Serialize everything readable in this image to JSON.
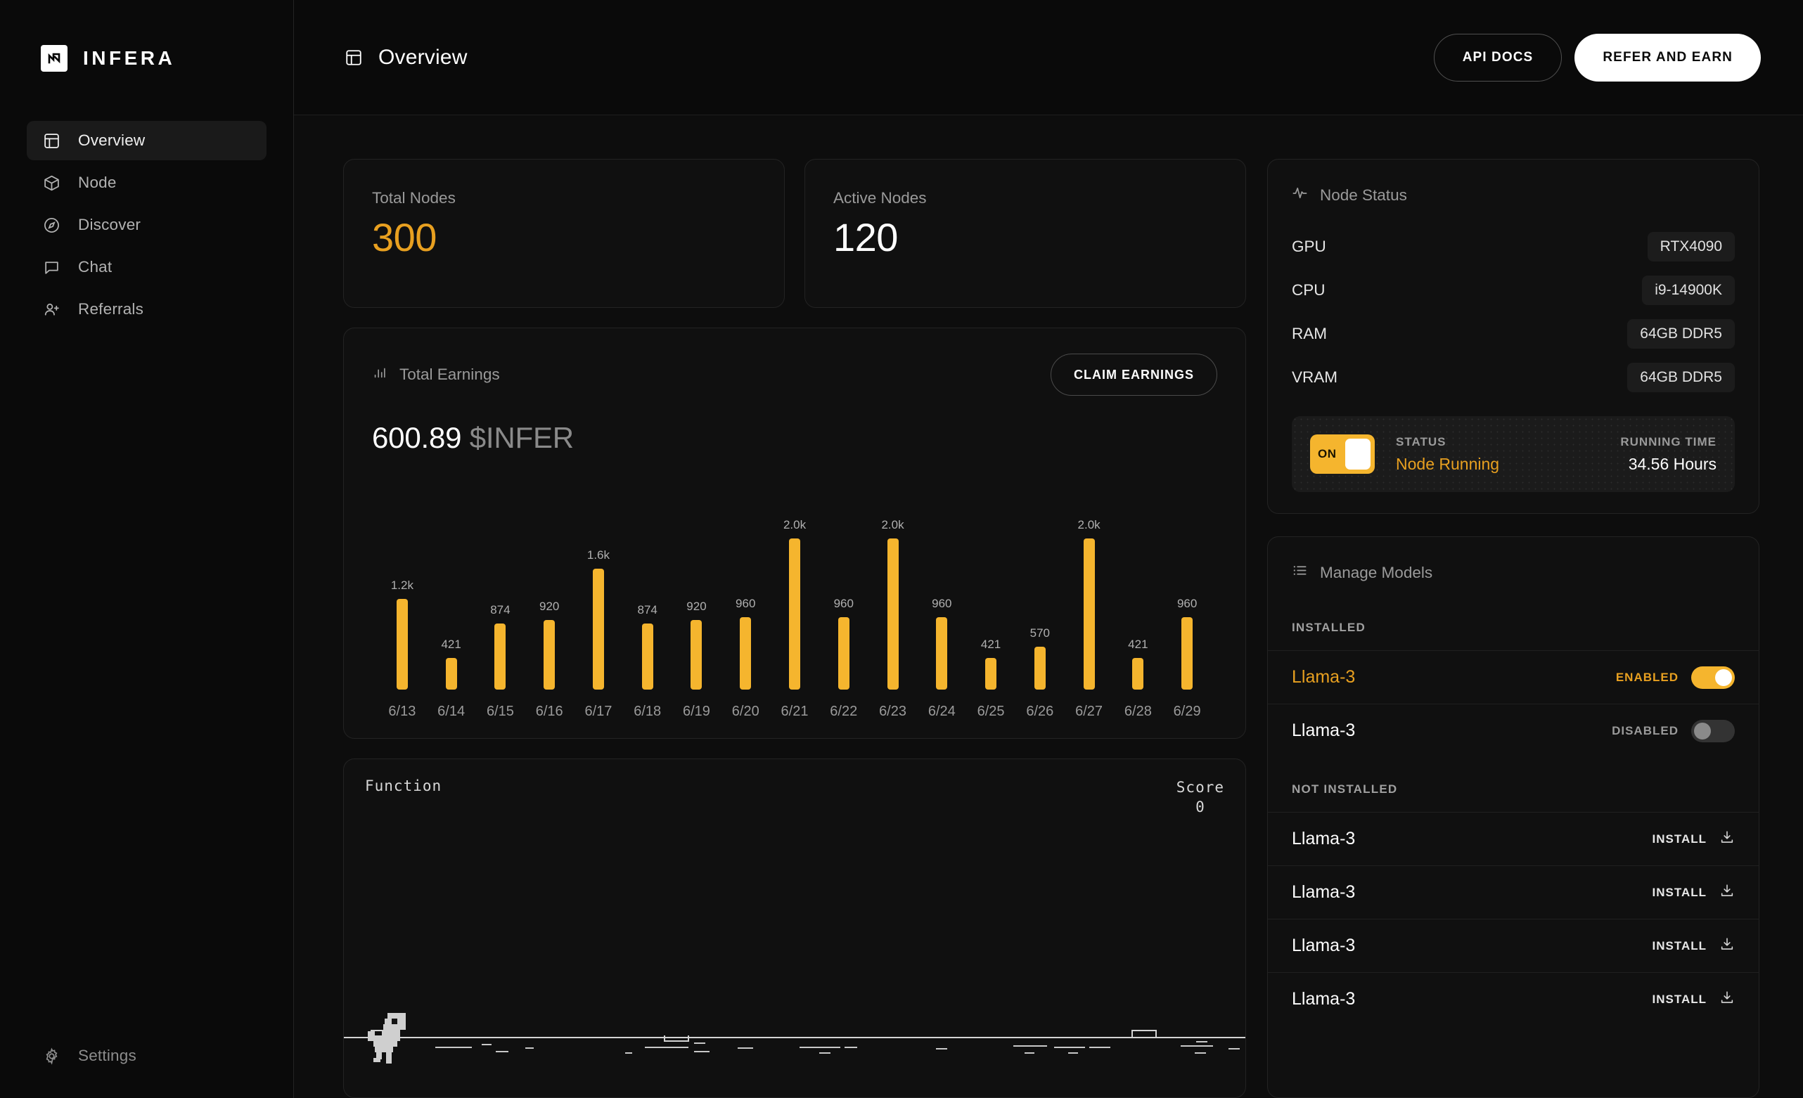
{
  "brand": {
    "name": "INFERA",
    "logo_icon": "infera-logo-icon"
  },
  "sidebar": {
    "items": [
      {
        "label": "Overview",
        "icon": "layout-dashboard-icon",
        "active": true
      },
      {
        "label": "Node",
        "icon": "cube-icon",
        "active": false
      },
      {
        "label": "Discover",
        "icon": "compass-icon",
        "active": false
      },
      {
        "label": "Chat",
        "icon": "chat-bubble-icon",
        "active": false
      },
      {
        "label": "Referrals",
        "icon": "user-plus-icon",
        "active": false
      }
    ],
    "settings": {
      "label": "Settings",
      "icon": "gear-icon"
    }
  },
  "topbar": {
    "title": "Overview",
    "title_icon": "layout-dashboard-icon",
    "api_docs_label": "API DOCS",
    "refer_label": "REFER AND EARN"
  },
  "stats": [
    {
      "label": "Total Nodes",
      "value": "300",
      "color": "#e8a020"
    },
    {
      "label": "Active Nodes",
      "value": "120",
      "color": "#ffffff"
    }
  ],
  "earnings": {
    "title": "Total Earnings",
    "title_icon": "bar-chart-icon",
    "claim_label": "CLAIM EARNINGS",
    "amount": "600.89",
    "ticker": "$INFER"
  },
  "chart_data": {
    "type": "bar",
    "title": "Total Earnings",
    "xlabel": "",
    "ylabel": "",
    "grid": false,
    "legend": "none",
    "bar_color": "#f5b52e",
    "categories": [
      "6/13",
      "6/14",
      "6/15",
      "6/16",
      "6/17",
      "6/18",
      "6/19",
      "6/20",
      "6/21",
      "6/22",
      "6/23",
      "6/24",
      "6/25",
      "6/26",
      "6/27",
      "6/28",
      "6/29"
    ],
    "values": [
      1200,
      421,
      874,
      920,
      1600,
      874,
      920,
      960,
      2000,
      960,
      2000,
      960,
      421,
      570,
      2000,
      421,
      960
    ],
    "value_labels": [
      "1.2k",
      "421",
      "874",
      "920",
      "1.6k",
      "874",
      "920",
      "960",
      "2.0k",
      "960",
      "2.0k",
      "960",
      "421",
      "570",
      "2.0k",
      "421",
      "960"
    ],
    "ylim": [
      0,
      2000
    ]
  },
  "game": {
    "function_label": "Function",
    "score_label": "Score",
    "score_value": "0",
    "dino_icon": "dino-runner-icon"
  },
  "node_status": {
    "title": "Node Status",
    "title_icon": "activity-pulse-icon",
    "specs": [
      {
        "key": "GPU",
        "value": "RTX4090"
      },
      {
        "key": "CPU",
        "value": "i9-14900K"
      },
      {
        "key": "RAM",
        "value": "64GB DDR5"
      },
      {
        "key": "VRAM",
        "value": "64GB DDR5"
      }
    ],
    "toggle_label": "ON",
    "status_caption": "STATUS",
    "status_value": "Node Running",
    "runtime_caption": "RUNNING TIME",
    "runtime_value": "34.56 Hours"
  },
  "manage_models": {
    "title": "Manage Models",
    "title_icon": "list-icon",
    "installed_label": "INSTALLED",
    "not_installed_label": "NOT INSTALLED",
    "installed": [
      {
        "name": "Llama-3",
        "state": "ENABLED",
        "enabled": true
      },
      {
        "name": "Llama-3",
        "state": "DISABLED",
        "enabled": false
      }
    ],
    "not_installed": [
      {
        "name": "Llama-3",
        "action": "INSTALL"
      },
      {
        "name": "Llama-3",
        "action": "INSTALL"
      },
      {
        "name": "Llama-3",
        "action": "INSTALL"
      },
      {
        "name": "Llama-3",
        "action": "INSTALL"
      }
    ]
  }
}
